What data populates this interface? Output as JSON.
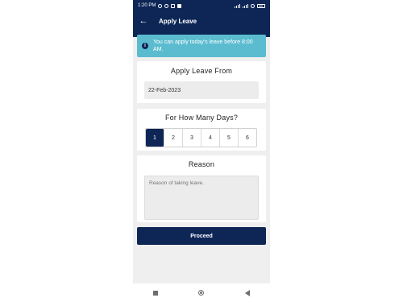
{
  "status_bar": {
    "time": "1:20 PM"
  },
  "app_bar": {
    "back_icon": "arrow-left-icon",
    "title": "Apply Leave"
  },
  "banner": {
    "icon": "info-icon",
    "text": "You can apply today's leave before 8:00 AM."
  },
  "apply_from": {
    "heading": "Apply Leave From",
    "date_value": "22-Feb-2023"
  },
  "days": {
    "heading": "For How Many Days?",
    "options": [
      "1",
      "2",
      "3",
      "4",
      "5",
      "6"
    ],
    "selected": "1"
  },
  "reason": {
    "heading": "Reason",
    "placeholder": "Reason of taking leave."
  },
  "proceed": {
    "label": "Proceed"
  },
  "colors": {
    "primary": "#0d2656",
    "banner": "#5bbcd0",
    "background": "#efefef"
  }
}
